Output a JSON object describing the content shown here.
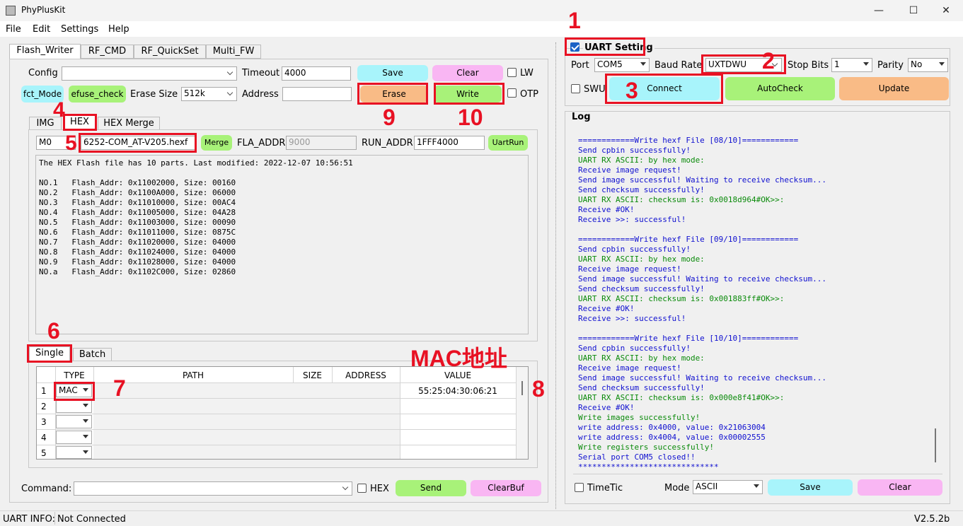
{
  "window": {
    "title": "PhyPlusKit",
    "minimize": "—",
    "maximize": "☐",
    "close": "✕"
  },
  "menu": [
    "File",
    "Edit",
    "Settings",
    "Help"
  ],
  "tabs": [
    "Flash_Writer",
    "RF_CMD",
    "RF_QuickSet",
    "Multi_FW"
  ],
  "flash": {
    "config_label": "Config",
    "config_value": "",
    "timeout_label": "Timeout",
    "timeout_value": "4000",
    "save": "Save",
    "clear": "Clear",
    "lw": "LW",
    "fct_mode": "fct_Mode",
    "efuse_check": "efuse_check",
    "erase_size_label": "Erase Size",
    "erase_size_value": "512k",
    "address_label": "Address",
    "address_value": "",
    "erase": "Erase",
    "write": "Write",
    "otp": "OTP"
  },
  "subtabs": [
    "IMG",
    "HEX",
    "HEX Merge"
  ],
  "hex": {
    "m0": "M0",
    "file": "6252-COM_AT-V205.hexf",
    "merge": "Merge",
    "fla_addr_label": "FLA_ADDR",
    "fla_addr_value": "9000",
    "run_addr_label": "RUN_ADDR",
    "run_addr_value": "1FFF4000",
    "uartrun": "UartRun",
    "info_lines": [
      "The HEX Flash file has 10 parts. Last modified: 2022-12-07 10:56:51",
      "",
      "NO.1   Flash_Addr: 0x11002000, Size: 00160",
      "NO.2   Flash_Addr: 0x1100A000, Size: 06000",
      "NO.3   Flash_Addr: 0x11010000, Size: 00AC4",
      "NO.4   Flash_Addr: 0x11005000, Size: 04A28",
      "NO.5   Flash_Addr: 0x11003000, Size: 00090",
      "NO.6   Flash_Addr: 0x11011000, Size: 0875C",
      "NO.7   Flash_Addr: 0x11020000, Size: 04000",
      "NO.8   Flash_Addr: 0x11024000, Size: 04000",
      "NO.9   Flash_Addr: 0x11028000, Size: 04000",
      "NO.a   Flash_Addr: 0x1102C000, Size: 02860"
    ]
  },
  "mode_tabs": [
    "Single",
    "Batch"
  ],
  "table": {
    "headers": [
      "TYPE",
      "PATH",
      "SIZE",
      "ADDRESS",
      "VALUE"
    ],
    "rows": [
      {
        "num": "1",
        "type": "MAC",
        "value": "55:25:04:30:06:21"
      },
      {
        "num": "2",
        "type": "",
        "value": ""
      },
      {
        "num": "3",
        "type": "",
        "value": ""
      },
      {
        "num": "4",
        "type": "",
        "value": ""
      },
      {
        "num": "5",
        "type": "",
        "value": ""
      }
    ]
  },
  "command": {
    "label": "Command:",
    "value": "",
    "hex": "HEX",
    "send": "Send",
    "clearbuf": "ClearBuf"
  },
  "status": {
    "label": "UART INFO:",
    "value": "Not Connected",
    "version": "V2.5.2b"
  },
  "uart": {
    "title": "UART Setting",
    "port_label": "Port",
    "port_value": "COM5",
    "baud_label": "Baud Rate",
    "baud_value": "UXTDWU",
    "stop_label": "Stop Bits",
    "stop_value": "1",
    "parity_label": "Parity",
    "parity_value": "No",
    "swu": "SWU",
    "connect": "Connect",
    "autocheck": "AutoCheck",
    "update": "Update"
  },
  "log": {
    "title": "Log",
    "lines": [
      {
        "t": "============Write hexf File [08/10]============",
        "c": "b"
      },
      {
        "t": "Send cpbin successfully!",
        "c": "b"
      },
      {
        "t": "UART RX ASCII: by hex mode:",
        "c": "g"
      },
      {
        "t": "Receive image request!",
        "c": "b"
      },
      {
        "t": "Send image successful! Waiting to receive checksum...",
        "c": "b"
      },
      {
        "t": "Send checksum successfully!",
        "c": "b"
      },
      {
        "t": "UART RX ASCII: checksum is: 0x0018d964#OK>>:",
        "c": "g"
      },
      {
        "t": "Receive #OK!",
        "c": "b"
      },
      {
        "t": "Receive >>: successful!",
        "c": "b"
      },
      {
        "t": "",
        "c": "b"
      },
      {
        "t": "============Write hexf File [09/10]============",
        "c": "b"
      },
      {
        "t": "Send cpbin successfully!",
        "c": "b"
      },
      {
        "t": "UART RX ASCII: by hex mode:",
        "c": "g"
      },
      {
        "t": "Receive image request!",
        "c": "b"
      },
      {
        "t": "Send image successful! Waiting to receive checksum...",
        "c": "b"
      },
      {
        "t": "Send checksum successfully!",
        "c": "b"
      },
      {
        "t": "UART RX ASCII: checksum is: 0x001883ff#OK>>:",
        "c": "g"
      },
      {
        "t": "Receive #OK!",
        "c": "b"
      },
      {
        "t": "Receive >>: successful!",
        "c": "b"
      },
      {
        "t": "",
        "c": "b"
      },
      {
        "t": "============Write hexf File [10/10]============",
        "c": "b"
      },
      {
        "t": "Send cpbin successfully!",
        "c": "b"
      },
      {
        "t": "UART RX ASCII: by hex mode:",
        "c": "g"
      },
      {
        "t": "Receive image request!",
        "c": "b"
      },
      {
        "t": "Send image successful! Waiting to receive checksum...",
        "c": "b"
      },
      {
        "t": "Send checksum successfully!",
        "c": "b"
      },
      {
        "t": "UART RX ASCII: checksum is: 0x000e8f41#OK>>:",
        "c": "g"
      },
      {
        "t": "Receive #OK!",
        "c": "b"
      },
      {
        "t": "Write images successfully!",
        "c": "g"
      },
      {
        "t": "write address: 0x4000, value: 0x21063004",
        "c": "b"
      },
      {
        "t": "write address: 0x4004, value: 0x00002555",
        "c": "b"
      },
      {
        "t": "Write registers successfully!",
        "c": "g"
      },
      {
        "t": "Serial port COM5 closed!!",
        "c": "b"
      },
      {
        "t": "******************************",
        "c": "b"
      }
    ],
    "timetic": "TimeTic",
    "mode_label": "Mode",
    "mode_value": "ASCII",
    "save": "Save",
    "clear": "Clear"
  },
  "annotations": {
    "a1": "1",
    "a2": "2",
    "a3": "3",
    "a4": "4",
    "a5": "5",
    "a6": "6",
    "a7": "7",
    "a8": "8",
    "a9": "9",
    "a10": "10",
    "mac": "MAC地址"
  },
  "colors": {
    "cyan": "#a8f4fb",
    "pink": "#f9b6f3",
    "green": "#a8f279",
    "orange": "#f9bb86",
    "red": "#e81123",
    "log_blue": "#1010d0",
    "log_green": "#0a8a0a"
  }
}
